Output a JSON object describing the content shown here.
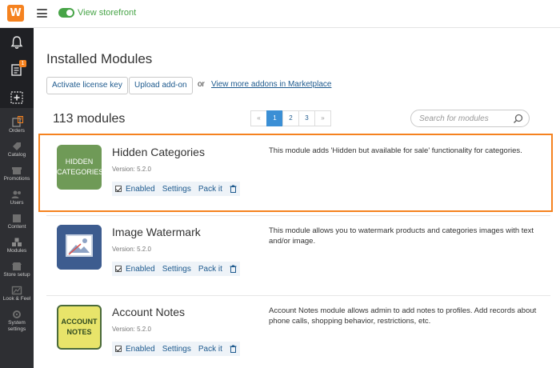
{
  "topbar": {
    "logo_glyph": "W",
    "storefront_label": "View storefront",
    "accent": "#f5821f",
    "toggle_color": "#47a447"
  },
  "sidebar": {
    "notification_badge": "1",
    "items": [
      {
        "label": "Orders",
        "icon": "orders-icon",
        "badge": "9"
      },
      {
        "label": "Catalog",
        "icon": "catalog-icon"
      },
      {
        "label": "Promotions",
        "icon": "promotions-icon"
      },
      {
        "label": "Users",
        "icon": "users-icon"
      },
      {
        "label": "Content",
        "icon": "content-icon"
      },
      {
        "label": "Modules",
        "icon": "modules-icon"
      },
      {
        "label": "Store setup",
        "icon": "store-setup-icon"
      },
      {
        "label": "Look & Feel",
        "icon": "look-feel-icon"
      },
      {
        "label": "System",
        "label2": "settings",
        "icon": "system-settings-icon"
      }
    ]
  },
  "main": {
    "title": "Installed Modules",
    "buttons": {
      "activate_license": "Activate license key",
      "upload_addon": "Upload add-on"
    },
    "or_text": "or",
    "marketplace_link": "View more addons in Marketplace",
    "modules_count": "113 modules",
    "pagination": {
      "prev": "«",
      "pages": [
        "1",
        "2",
        "3"
      ],
      "next": "»",
      "active_page": "1"
    },
    "search": {
      "placeholder": "Search for modules"
    },
    "modules": [
      {
        "name": "Hidden Categories",
        "version": "Version: 5.2.0",
        "icon_text": [
          "HIDDEN",
          "CATEGORIES"
        ],
        "icon_color": "#6f9a57",
        "enabled_label": "Enabled",
        "settings_label": "Settings",
        "packit_label": "Pack it",
        "description": "This module adds 'Hidden but available for sale' functionality for categories."
      },
      {
        "name": "Image Watermark",
        "version": "Version: 5.2.0",
        "icon_color": "#3d5c8f",
        "enabled_label": "Enabled",
        "settings_label": "Settings",
        "packit_label": "Pack it",
        "description": "This module allows you to watermark products and categories images with text and/or image."
      },
      {
        "name": "Account Notes",
        "version": "Version: 5.2.0",
        "icon_text": [
          "ACCOUNT",
          "NOTES"
        ],
        "icon_color": "#e8e46a",
        "enabled_label": "Enabled",
        "settings_label": "Settings",
        "packit_label": "Pack it",
        "description": "Account Notes module allows admin to add notes to profiles. Add records about phone calls, shopping behavior, restrictions, etc."
      }
    ]
  }
}
